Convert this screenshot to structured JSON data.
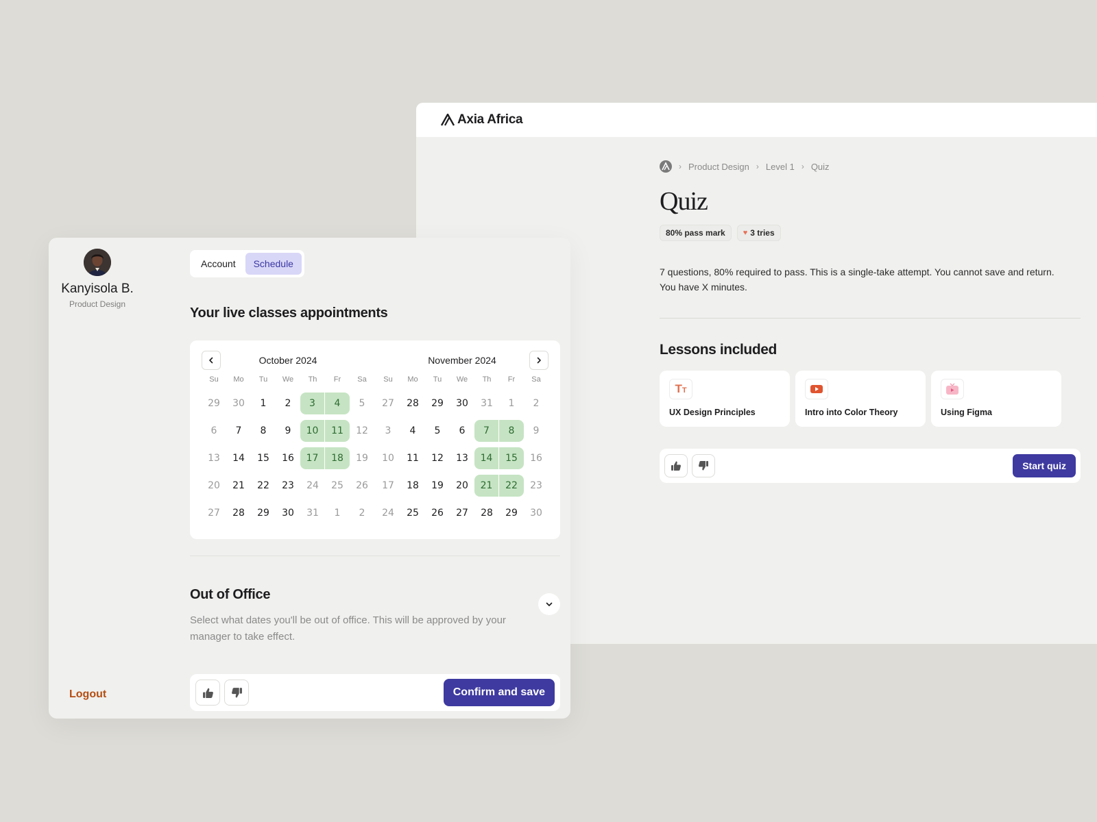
{
  "quiz_window": {
    "brand": "Axia Africa",
    "breadcrumb": [
      "Product Design",
      "Level 1",
      "Quiz"
    ],
    "title": "Quiz",
    "chips": {
      "pass_mark": "80% pass mark",
      "tries": "3 tries"
    },
    "description": "7 questions, 80% required to pass. This is a single-take attempt. You cannot save and return. You have X minutes.",
    "lessons_title": "Lessons included",
    "lessons": [
      {
        "label": "UX Design Principles",
        "icon": "typography-icon"
      },
      {
        "label": "Intro into Color Theory",
        "icon": "video-play-icon"
      },
      {
        "label": "Using Figma",
        "icon": "tv-icon"
      }
    ],
    "start_label": "Start quiz"
  },
  "profile": {
    "name": "Kanyisola B.",
    "role": "Product Design",
    "logout": "Logout"
  },
  "tabs": {
    "account": "Account",
    "schedule": "Schedule",
    "active": "Schedule"
  },
  "schedule": {
    "title": "Your live classes appointments",
    "weekdays": [
      "Su",
      "Mo",
      "Tu",
      "We",
      "Th",
      "Fr",
      "Sa"
    ],
    "months": [
      {
        "label": "October 2024",
        "weeks": [
          [
            "29",
            "30",
            "1",
            "2",
            "3",
            "4",
            "5"
          ],
          [
            "6",
            "7",
            "8",
            "9",
            "10",
            "11",
            "12"
          ],
          [
            "13",
            "14",
            "15",
            "16",
            "17",
            "18",
            "19"
          ],
          [
            "20",
            "21",
            "22",
            "23",
            "24",
            "25",
            "26"
          ],
          [
            "27",
            "28",
            "29",
            "30",
            "31",
            "1",
            "2"
          ]
        ],
        "muted": [
          [
            0,
            0
          ],
          [
            0,
            1
          ],
          [
            0,
            6
          ],
          [
            1,
            0
          ],
          [
            1,
            6
          ],
          [
            2,
            0
          ],
          [
            2,
            6
          ],
          [
            3,
            0
          ],
          [
            3,
            4
          ],
          [
            3,
            5
          ],
          [
            3,
            6
          ],
          [
            4,
            0
          ],
          [
            4,
            4
          ],
          [
            4,
            5
          ],
          [
            4,
            6
          ]
        ],
        "available": [
          [
            0,
            4
          ],
          [
            0,
            5
          ],
          [
            1,
            4
          ],
          [
            1,
            5
          ],
          [
            2,
            4
          ],
          [
            2,
            5
          ]
        ]
      },
      {
        "label": "November 2024",
        "weeks": [
          [
            "27",
            "28",
            "29",
            "30",
            "31",
            "1",
            "2"
          ],
          [
            "3",
            "4",
            "5",
            "6",
            "7",
            "8",
            "9"
          ],
          [
            "10",
            "11",
            "12",
            "13",
            "14",
            "15",
            "16"
          ],
          [
            "17",
            "18",
            "19",
            "20",
            "21",
            "22",
            "23"
          ],
          [
            "24",
            "25",
            "26",
            "27",
            "28",
            "29",
            "30"
          ]
        ],
        "muted": [
          [
            0,
            0
          ],
          [
            0,
            4
          ],
          [
            0,
            5
          ],
          [
            0,
            6
          ],
          [
            1,
            0
          ],
          [
            1,
            6
          ],
          [
            2,
            0
          ],
          [
            2,
            6
          ],
          [
            3,
            0
          ],
          [
            3,
            6
          ],
          [
            4,
            0
          ],
          [
            4,
            6
          ]
        ],
        "available": [
          [
            1,
            4
          ],
          [
            1,
            5
          ],
          [
            2,
            4
          ],
          [
            2,
            5
          ],
          [
            3,
            4
          ],
          [
            3,
            5
          ]
        ]
      }
    ],
    "available_color": "#c6e4c3",
    "out_of_office": {
      "title": "Out of Office",
      "description": "Select what dates you'll be out of office. This will be approved by your manager to take effect."
    },
    "confirm_label": "Confirm and save"
  },
  "colors": {
    "primary": "#3e3aa0",
    "logout": "#b44d12",
    "tab_active_bg": "#d9d7f7"
  }
}
